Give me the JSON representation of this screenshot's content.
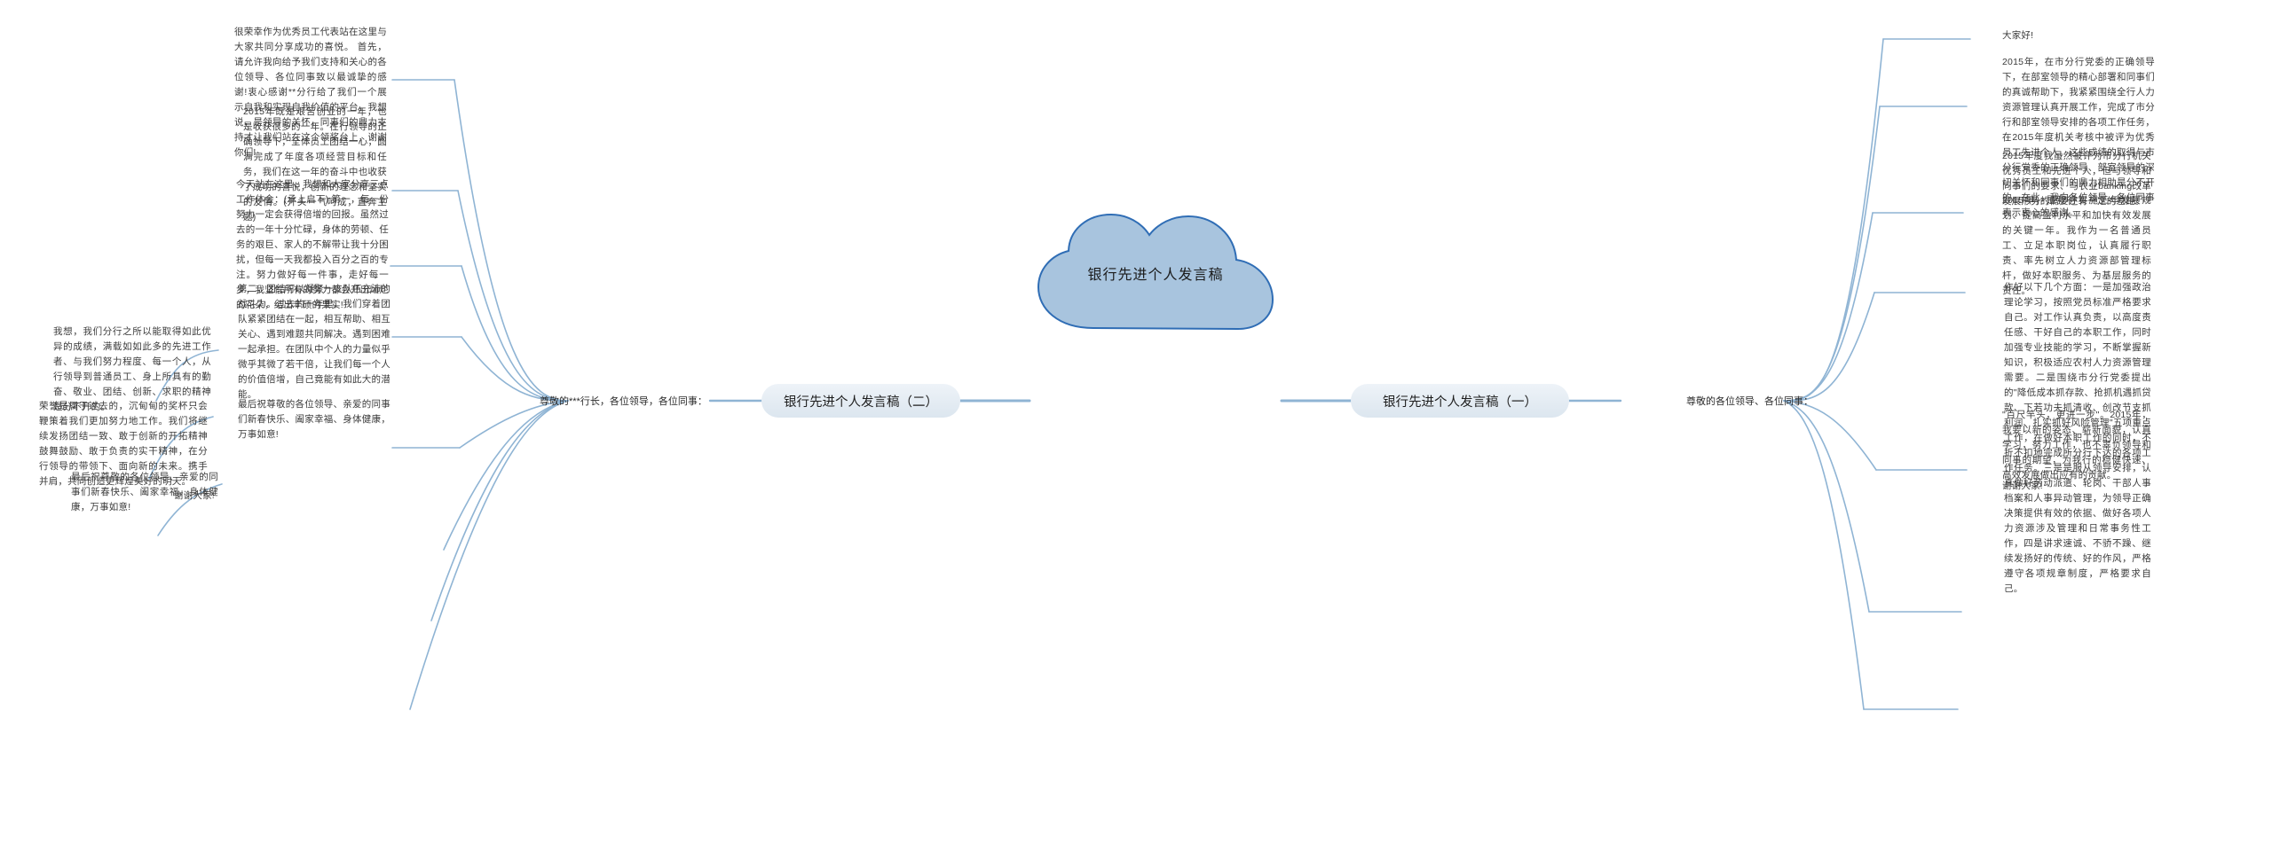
{
  "document": {
    "type": "mindmap",
    "title": "银行先进个人发言稿",
    "accent_color": "#8fb4d4",
    "node_fill": "#a8c4de",
    "node_stroke": "#2f6db5",
    "branch_fill": "#e3ebf3",
    "text_color": "#3b3b3b",
    "background": "#ffffff"
  },
  "center": {
    "label": "银行先进个人发言稿"
  },
  "branches": [
    {
      "id": "branch-two",
      "side": "left",
      "label": "银行先进个人发言稿（二）",
      "salutation": "尊敬的***行长，各位领导，各位同事：",
      "leaves": [
        "很荣幸作为优秀员工代表站在这里与大家共同分享成功的喜悦。 首先，请允许我向给予我们支持和关心的各位领导、各位同事致以最诚挚的感谢!衷心感谢**分行给了我们一个展示自我和实现自我价值的平台，我想说，是领导的关怀，同事们的鼎力支持才让我们站在这个领奖台上，谢谢你们!",
        "2015年既是艰苦创业的一年，也是收获很多的一年。在行领导的正确领导下，全体员工团结一心，圆满完成了年度各项经营目标和任务，我们在这一年的奋斗中也收获了成功的喜悦，创新的理念和坚实的友情。(开头一气呵成，直奔主题)",
        "今天站在这里，我想和大家分享三点工作体会：(承上启下) 第一，每一份努力一定会获得倍增的回报。虽然过去的一年十分忙碌，身体的劳顿、任务的艰巨、家人的不解带让我十分困扰，但每一天我都投入百分之百的专注。努力做好每一件事，走好每一步，我坚信所有的努力都会开出灿烂的花朵，结出丰硕的果实!",
        "第二，团结可以凝聚一支队伍充沛的战斗力。过去的一年里，我们穿着团队紧紧团结在一起，相互帮助、相互关心、遇到难题共同解决。遇到困难一起承担。在团队中个人的力量似乎微乎其微了若干倍，让我们每一个人的价值倍增，自己竟能有如此大的潜能。",
        "我想，我们分行之所以能取得如此优异的成绩，满载如如此多的先进工作者、与我们努力程度、每一个人，从行领导到普通员工、身上所具有的勤奋、敬业、团结、创新、求职的精神是分不开的。",
        "荣誉是属于过去的，沉甸甸的奖杯只会鞭策着我们更加努力地工作。我们将继续发扬团结一致、敢于创新的开拓精神鼓舞鼓励、敢于负责的实干精神，在分行领导的带领下、面向新的未来。携手并肩，共同创造更辉煌美好的明天。",
        "最后祝尊敬的各位领导、亲爱的同事们新春快乐、阖家幸福、身体健康，万事如意!",
        "谢谢大家!"
      ]
    },
    {
      "id": "branch-one",
      "side": "right",
      "label": "银行先进个人发言稿（一）",
      "salutation": "尊敬的各位领导、各位同事：",
      "leaves": [
        "大家好!",
        "2015年，在市分行党委的正确领导下，在部室领导的精心部署和同事们的真诚帮助下，我紧紧围绕全行人力资源管理认真开展工作，完成了市分行和部室领导安排的各项工作任务，在2015年度机关考核中被评为优秀员工先进个人。这些成绩的取得与市分行党委的正确领导、部室领导的深切关怀和同事们的鼎力相助是分不开的。在此，我向各位领导、各位同事表示衷心的感谢。",
        "2015年度我虽然被评为市分行机关优秀员工和先进个人，但与领导和同事们的要求、与农业banking改革发展形势的需要还有一定的差距。",
        "2015年，是我行实施三年发展规划、提高盈利水平和加快有效发展的关键一年。我作为一名普通员工、立足本职岗位，认真履行职责、率先树立人力资源部管理标杆，做好本职服务、为基层服务的责任。",
        "作好以下几个方面：一是加强政治理论学习，按照党员标准严格要求自己。对工作认真负责，以高度责任感、干好自己的本职工作，同时加强专业技能的学习，不断掌握新知识，积极适应农村人力资源管理需要。二是围绕市分行党委提出的\"降低成本抓存款、抢抓机遇抓贷款、下若功夫抓清收、创改节支抓利润、扎实抓好风险管理\"五项重点工作，在做好本职工作的同时，不折不扣地完成所分行下达的各项工作任务。三是是服从领导安排，认真做好劳动派遣、轮岗、干部人事档案和人事异动管理，为领导正确决策提供有效的依据、做好各项人力资源涉及管理和日常事务性工作，四是讲求速诚、不骄不躁、继续发扬好的传统、好的作风，严格遵守各项规章制度，严格要求自己。",
        "\"百尺竿头，更进一步\"。2015年，我要以新的姿态、崭新面貌，认真学习，努力工作，也不辜负领导和同事的期望，为我行的稳健快速、高效发展做出应有的贡献。",
        "谢谢大家!"
      ]
    }
  ]
}
